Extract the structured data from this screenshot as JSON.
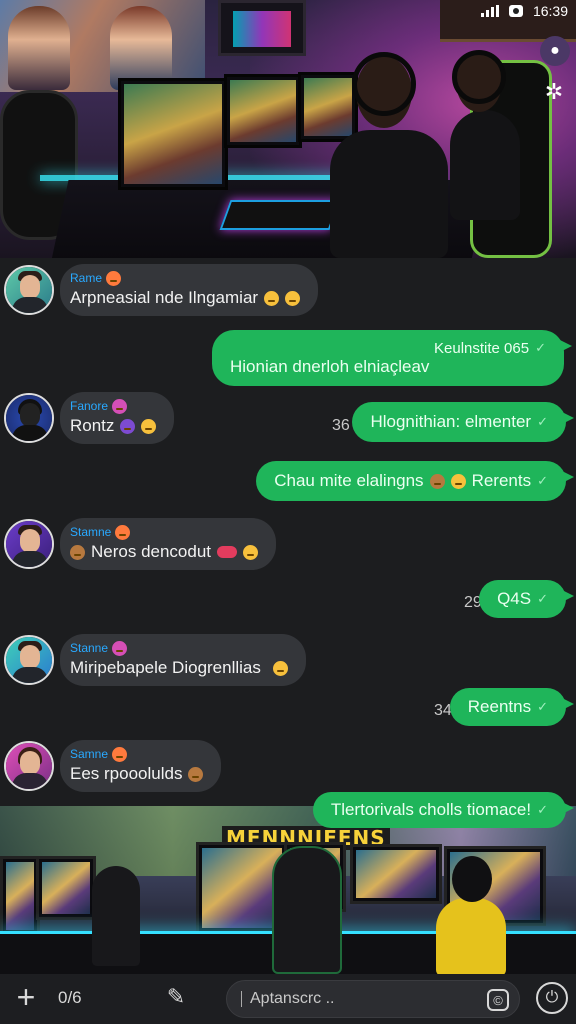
{
  "status_bar": {
    "time": "16:39"
  },
  "top_icons": {
    "pin_icon": "pin-icon",
    "settings_icon": "gear-icon"
  },
  "chat": {
    "messages": [
      {
        "kind": "in",
        "name": "Rame",
        "text": "Arpneasial nde Ilngamiar"
      },
      {
        "kind": "out",
        "text_top": "Keulnstite 065",
        "text_bottom": "Hionian dnerloh elniaçleav"
      },
      {
        "kind": "in",
        "name": "Fanore",
        "text": "Rontz"
      },
      {
        "kind": "out",
        "count": "36",
        "text": "Hlognithian: elmenter"
      },
      {
        "kind": "out",
        "text": "Chau mite elalingns",
        "text_after": "Rerents"
      },
      {
        "kind": "in",
        "name": "Stamne",
        "text": "Neros dencodut"
      },
      {
        "kind": "out",
        "count": "29",
        "text": "Q4S"
      },
      {
        "kind": "in",
        "name": "Stanne",
        "text": "Miripebapele Diogrenllias"
      },
      {
        "kind": "out",
        "count": "34",
        "text": "Reentns"
      },
      {
        "kind": "in",
        "name": "Samne",
        "text": "Ees rpooolulds"
      },
      {
        "kind": "out",
        "text": "Tlertorivals cholls tiomace!"
      }
    ]
  },
  "bottom_photo": {
    "banner": "MENNNIEENS"
  },
  "input_bar": {
    "counter": "0/6",
    "placeholder": "Aptanscrc .."
  }
}
